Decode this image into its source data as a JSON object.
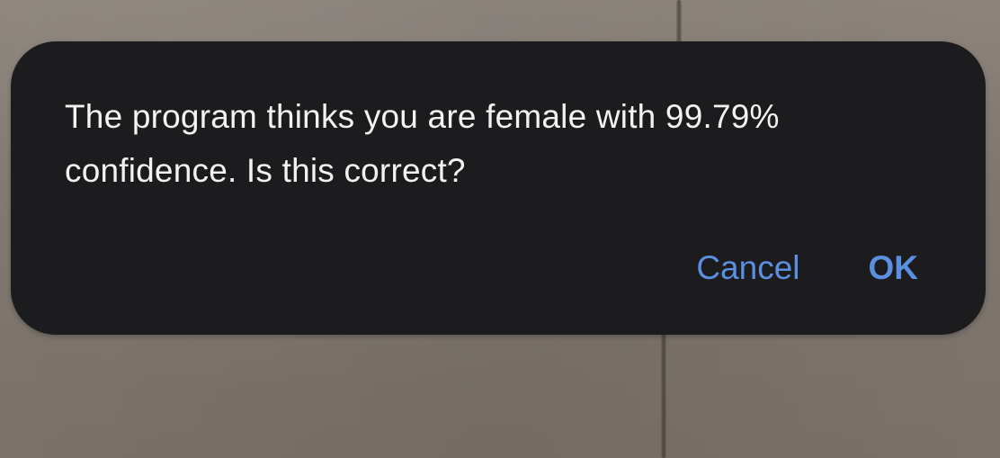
{
  "alert": {
    "message": "The program thinks you are female with 99.79% confidence. Is this correct?",
    "cancel_label": "Cancel",
    "ok_label": "OK"
  },
  "colors": {
    "alert_background": "#1c1c1e",
    "message_text": "#f2f2f2",
    "button_text": "#5b8fe0"
  }
}
